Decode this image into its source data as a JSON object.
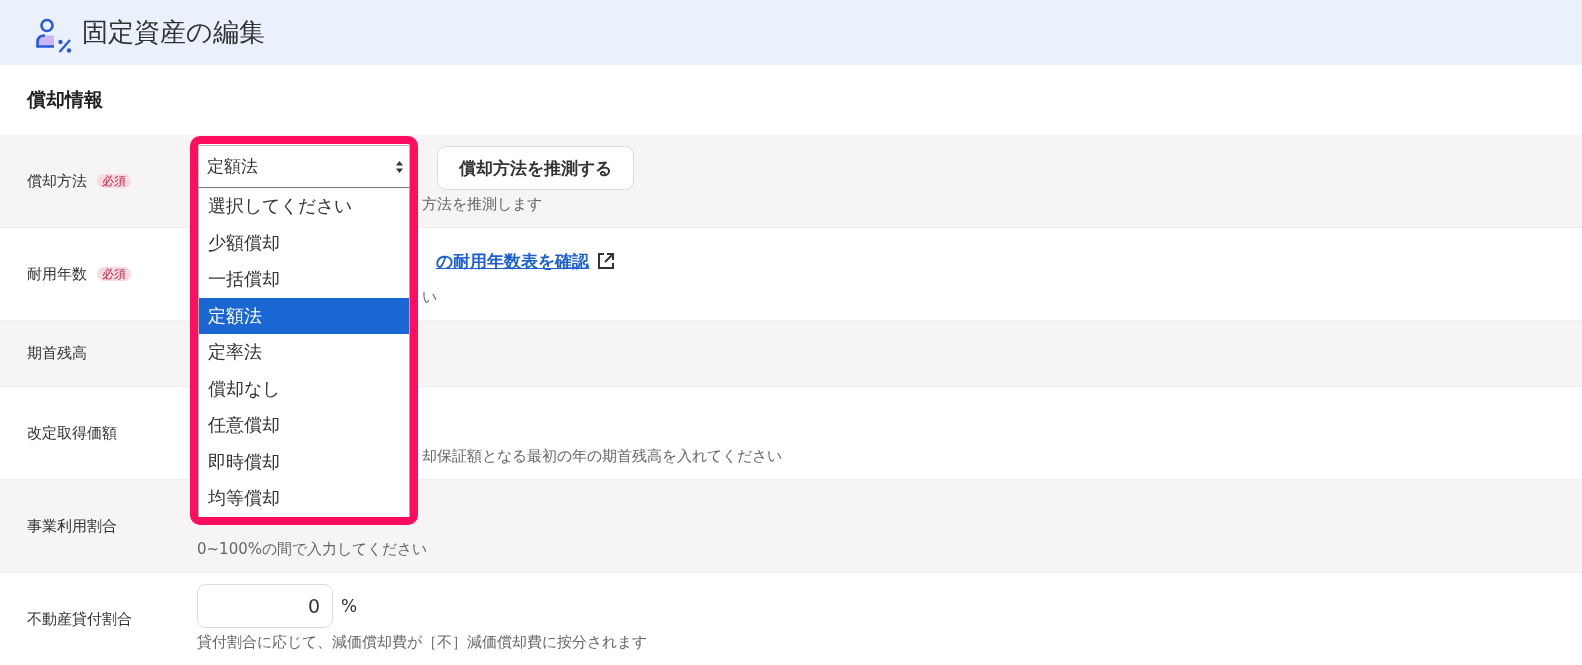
{
  "header": {
    "title": "固定資産の編集"
  },
  "section": {
    "title": "償却情報"
  },
  "rows": [
    {
      "kind": "method",
      "label": "償却方法",
      "tag": "必須",
      "select": {
        "value": "定額法",
        "expanded": true,
        "highlighted": true,
        "options": [
          {
            "label": "選択してください",
            "selected": false
          },
          {
            "label": "少額償却",
            "selected": false
          },
          {
            "label": "一括償却",
            "selected": false
          },
          {
            "label": "定額法",
            "selected": true
          },
          {
            "label": "定率法",
            "selected": false
          },
          {
            "label": "償却なし",
            "selected": false
          },
          {
            "label": "任意償却",
            "selected": false
          },
          {
            "label": "即時償却",
            "selected": false
          },
          {
            "label": "均等償却",
            "selected": false
          }
        ]
      },
      "button": "償却方法を推測する",
      "hint": "方法を推測します"
    },
    {
      "kind": "link",
      "label": "耐用年数",
      "tag": "必須",
      "link": "の耐用年数表を確認",
      "hint": "い"
    },
    {
      "kind": "blank",
      "label": "期首残高"
    },
    {
      "kind": "blank",
      "label": "改定取得価額",
      "hint": "却保証額となる最初の年の期首残高を入れてください"
    },
    {
      "kind": "blank",
      "label": "事業利用割合",
      "hint": "0~100%の間で入力してください"
    },
    {
      "kind": "percent",
      "label": "不動産貸付割合",
      "input": {
        "value": "0"
      },
      "unit": "%",
      "hint": "貸付割合に応じて、減価償却費が［不］減価償却費に按分されます"
    }
  ]
}
